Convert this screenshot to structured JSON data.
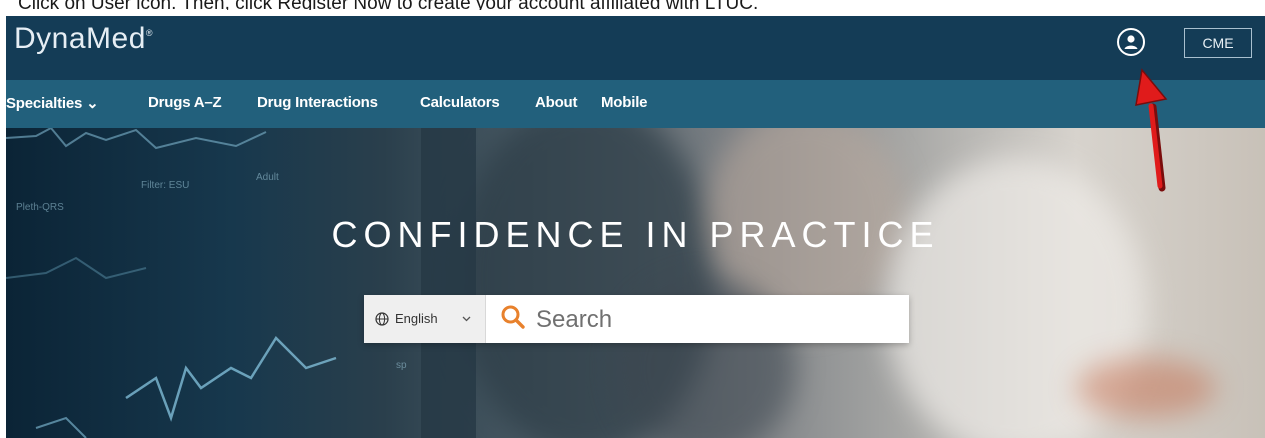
{
  "instruction": "Click on User icon. Then, click Register Now to create your account affiliated with LTUC.",
  "header": {
    "logo_text": "DynaMed",
    "logo_mark": "®",
    "user_icon": "user-circle-icon",
    "cme_label": "CME"
  },
  "nav": {
    "items": [
      {
        "label": "Specialties ⌄"
      },
      {
        "label": "Drugs A–Z"
      },
      {
        "label": "Drug Interactions"
      },
      {
        "label": "Calculators"
      },
      {
        "label": "About"
      },
      {
        "label": "Mobile"
      }
    ]
  },
  "hero": {
    "title": "CONFIDENCE IN PRACTICE",
    "monitor_labels": [
      "Filter: ESU",
      "Adult",
      "Pleth-QRS",
      "sp"
    ],
    "search": {
      "language": "English",
      "placeholder": "Search"
    }
  },
  "colors": {
    "header_bg": "#143c56",
    "nav_bg": "#22607c",
    "search_icon": "#e8812c",
    "annotation_arrow": "#e01b1b"
  }
}
